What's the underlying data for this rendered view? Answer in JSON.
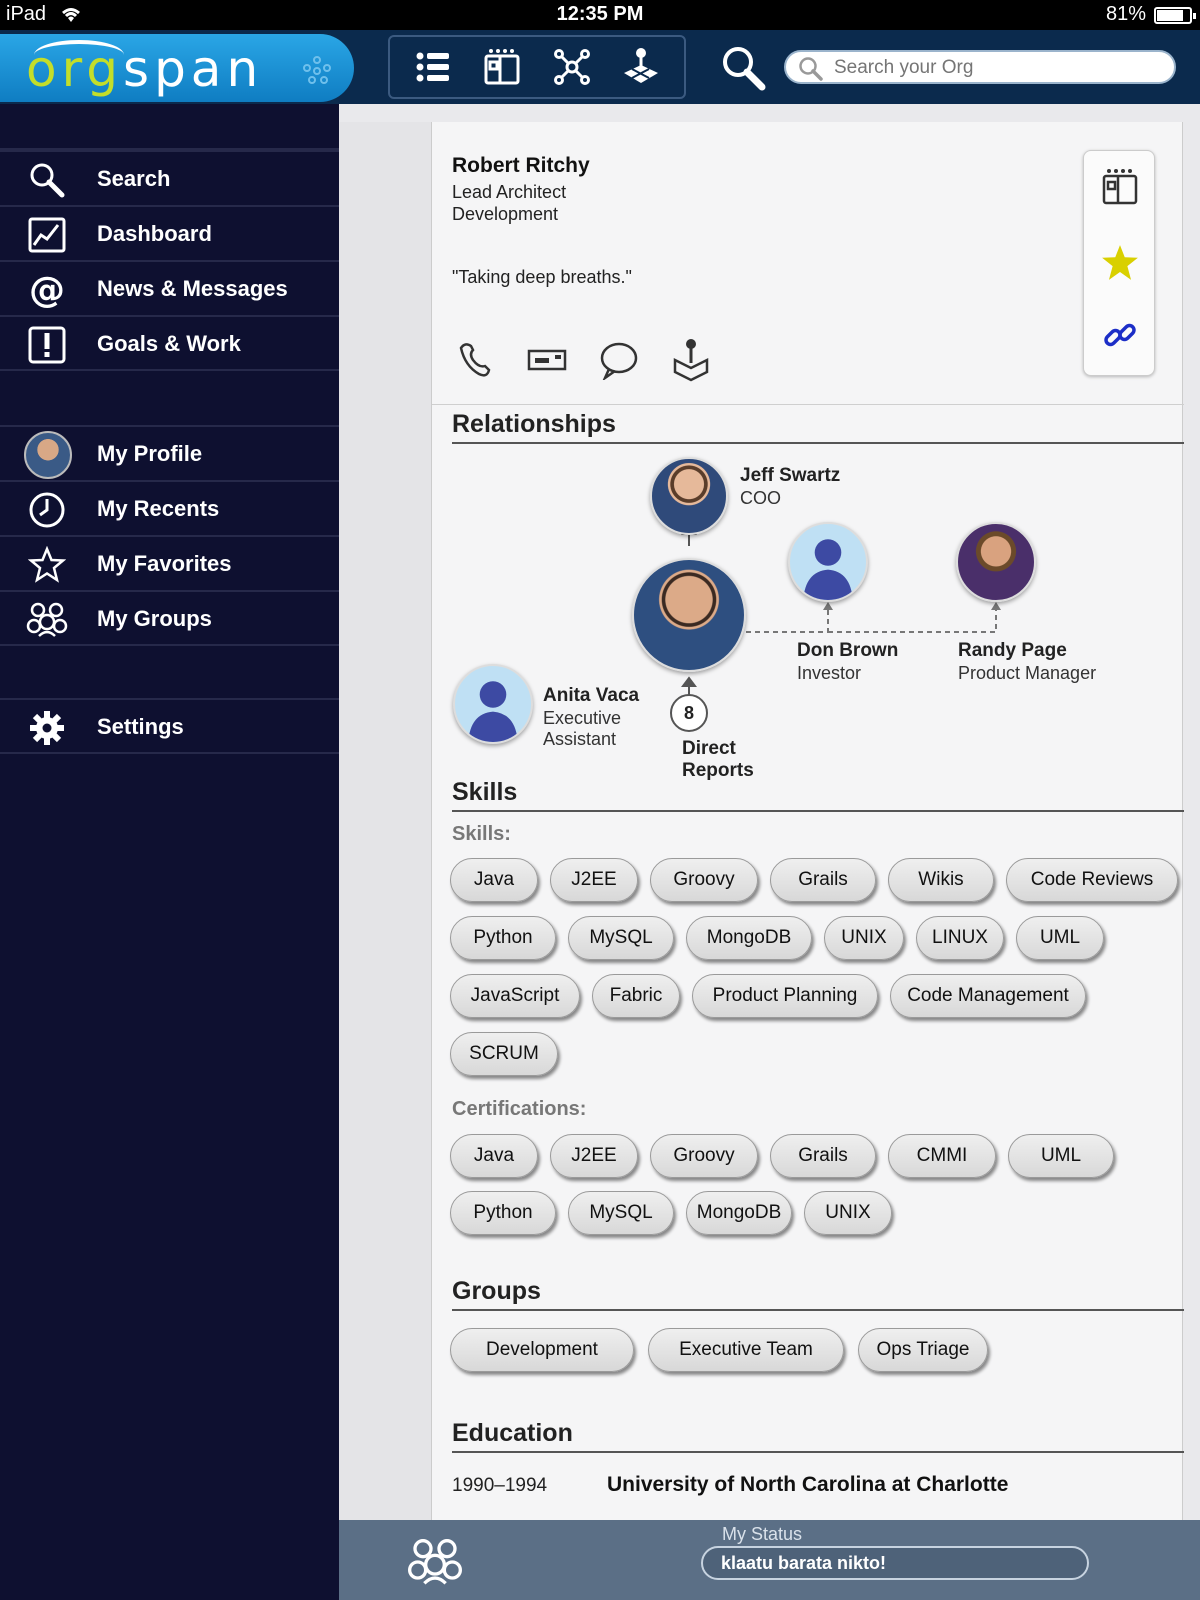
{
  "status_bar": {
    "device": "iPad",
    "time": "12:35 PM",
    "battery": "81%",
    "battery_level": 0.81
  },
  "brand": {
    "logo_text_1": "org",
    "logo_text_2": "span",
    "accent": "#c3de2a",
    "brand_blue": "#1a8fd6"
  },
  "search": {
    "placeholder": "Search your Org"
  },
  "view_tabs": [
    "list-view-icon",
    "card-view-icon",
    "network-view-icon",
    "map-view-icon"
  ],
  "sidebar": {
    "items": [
      {
        "label": "Search",
        "icon": "search-icon"
      },
      {
        "label": "Dashboard",
        "icon": "chart-icon"
      },
      {
        "label": "News & Messages",
        "icon": "at-icon"
      },
      {
        "label": "Goals & Work",
        "icon": "exclamation-icon"
      },
      {
        "label": "My Profile",
        "icon": "avatar"
      },
      {
        "label": "My Recents",
        "icon": "clock-icon"
      },
      {
        "label": "My Favorites",
        "icon": "star-icon"
      },
      {
        "label": "My Groups",
        "icon": "groups-icon"
      },
      {
        "label": "Settings",
        "icon": "gear-icon"
      }
    ]
  },
  "profile": {
    "name": "Robert Ritchy",
    "title": "Lead Architect",
    "department": "Development",
    "quote": "\"Taking deep breaths.\"",
    "actions": [
      "phone-icon",
      "email-icon",
      "chat-icon",
      "location-icon"
    ],
    "side_actions": [
      "card-icon",
      "favorite-star-icon",
      "link-icon"
    ]
  },
  "relationships": {
    "title": "Relationships",
    "manager": {
      "name": "Jeff Swartz",
      "title": "COO"
    },
    "peers": [
      {
        "name": "Don Brown",
        "title": "Investor"
      },
      {
        "name": "Randy Page",
        "title": "Product Manager"
      }
    ],
    "assistant": {
      "name": "Anita Vaca",
      "title_line1": "Executive",
      "title_line2": "Assistant"
    },
    "direct_reports": {
      "count": "8",
      "label_line1": "Direct",
      "label_line2": "Reports"
    }
  },
  "skills": {
    "title": "Skills",
    "skills_label": "Skills:",
    "skills": [
      "Java",
      "J2EE",
      "Groovy",
      "Grails",
      "Wikis",
      "Code Reviews",
      "Python",
      "MySQL",
      "MongoDB",
      "UNIX",
      "LINUX",
      "UML",
      "JavaScript",
      "Fabric",
      "Product Planning",
      "Code Management",
      "SCRUM"
    ],
    "certs_label": "Certifications:",
    "certifications": [
      "Java",
      "J2EE",
      "Groovy",
      "Grails",
      "CMMI",
      "UML",
      "Python",
      "MySQL",
      "MongoDB",
      "UNIX"
    ]
  },
  "groups": {
    "title": "Groups",
    "items": [
      "Development",
      "Executive Team",
      "Ops Triage"
    ]
  },
  "education": {
    "title": "Education",
    "years": "1990–1994",
    "school": "University of North Carolina at Charlotte"
  },
  "my_status": {
    "label": "My Status",
    "value": "klaatu barata nikto!"
  }
}
